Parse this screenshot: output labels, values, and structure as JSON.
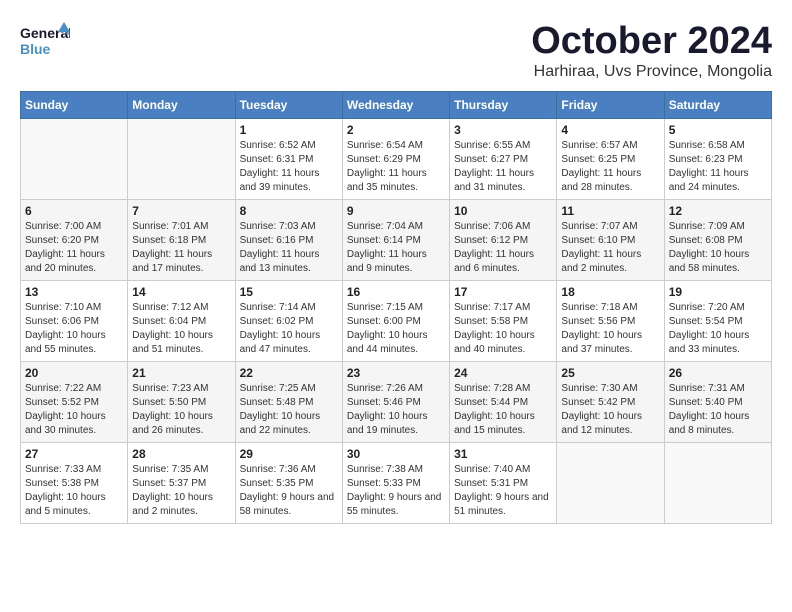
{
  "header": {
    "logo": {
      "general": "General",
      "blue": "Blue"
    },
    "month": "October 2024",
    "location": "Harhiraa, Uvs Province, Mongolia"
  },
  "weekdays": [
    "Sunday",
    "Monday",
    "Tuesday",
    "Wednesday",
    "Thursday",
    "Friday",
    "Saturday"
  ],
  "weeks": [
    [
      {
        "day": "",
        "sunrise": "",
        "sunset": "",
        "daylight": ""
      },
      {
        "day": "",
        "sunrise": "",
        "sunset": "",
        "daylight": ""
      },
      {
        "day": "1",
        "sunrise": "Sunrise: 6:52 AM",
        "sunset": "Sunset: 6:31 PM",
        "daylight": "Daylight: 11 hours and 39 minutes."
      },
      {
        "day": "2",
        "sunrise": "Sunrise: 6:54 AM",
        "sunset": "Sunset: 6:29 PM",
        "daylight": "Daylight: 11 hours and 35 minutes."
      },
      {
        "day": "3",
        "sunrise": "Sunrise: 6:55 AM",
        "sunset": "Sunset: 6:27 PM",
        "daylight": "Daylight: 11 hours and 31 minutes."
      },
      {
        "day": "4",
        "sunrise": "Sunrise: 6:57 AM",
        "sunset": "Sunset: 6:25 PM",
        "daylight": "Daylight: 11 hours and 28 minutes."
      },
      {
        "day": "5",
        "sunrise": "Sunrise: 6:58 AM",
        "sunset": "Sunset: 6:23 PM",
        "daylight": "Daylight: 11 hours and 24 minutes."
      }
    ],
    [
      {
        "day": "6",
        "sunrise": "Sunrise: 7:00 AM",
        "sunset": "Sunset: 6:20 PM",
        "daylight": "Daylight: 11 hours and 20 minutes."
      },
      {
        "day": "7",
        "sunrise": "Sunrise: 7:01 AM",
        "sunset": "Sunset: 6:18 PM",
        "daylight": "Daylight: 11 hours and 17 minutes."
      },
      {
        "day": "8",
        "sunrise": "Sunrise: 7:03 AM",
        "sunset": "Sunset: 6:16 PM",
        "daylight": "Daylight: 11 hours and 13 minutes."
      },
      {
        "day": "9",
        "sunrise": "Sunrise: 7:04 AM",
        "sunset": "Sunset: 6:14 PM",
        "daylight": "Daylight: 11 hours and 9 minutes."
      },
      {
        "day": "10",
        "sunrise": "Sunrise: 7:06 AM",
        "sunset": "Sunset: 6:12 PM",
        "daylight": "Daylight: 11 hours and 6 minutes."
      },
      {
        "day": "11",
        "sunrise": "Sunrise: 7:07 AM",
        "sunset": "Sunset: 6:10 PM",
        "daylight": "Daylight: 11 hours and 2 minutes."
      },
      {
        "day": "12",
        "sunrise": "Sunrise: 7:09 AM",
        "sunset": "Sunset: 6:08 PM",
        "daylight": "Daylight: 10 hours and 58 minutes."
      }
    ],
    [
      {
        "day": "13",
        "sunrise": "Sunrise: 7:10 AM",
        "sunset": "Sunset: 6:06 PM",
        "daylight": "Daylight: 10 hours and 55 minutes."
      },
      {
        "day": "14",
        "sunrise": "Sunrise: 7:12 AM",
        "sunset": "Sunset: 6:04 PM",
        "daylight": "Daylight: 10 hours and 51 minutes."
      },
      {
        "day": "15",
        "sunrise": "Sunrise: 7:14 AM",
        "sunset": "Sunset: 6:02 PM",
        "daylight": "Daylight: 10 hours and 47 minutes."
      },
      {
        "day": "16",
        "sunrise": "Sunrise: 7:15 AM",
        "sunset": "Sunset: 6:00 PM",
        "daylight": "Daylight: 10 hours and 44 minutes."
      },
      {
        "day": "17",
        "sunrise": "Sunrise: 7:17 AM",
        "sunset": "Sunset: 5:58 PM",
        "daylight": "Daylight: 10 hours and 40 minutes."
      },
      {
        "day": "18",
        "sunrise": "Sunrise: 7:18 AM",
        "sunset": "Sunset: 5:56 PM",
        "daylight": "Daylight: 10 hours and 37 minutes."
      },
      {
        "day": "19",
        "sunrise": "Sunrise: 7:20 AM",
        "sunset": "Sunset: 5:54 PM",
        "daylight": "Daylight: 10 hours and 33 minutes."
      }
    ],
    [
      {
        "day": "20",
        "sunrise": "Sunrise: 7:22 AM",
        "sunset": "Sunset: 5:52 PM",
        "daylight": "Daylight: 10 hours and 30 minutes."
      },
      {
        "day": "21",
        "sunrise": "Sunrise: 7:23 AM",
        "sunset": "Sunset: 5:50 PM",
        "daylight": "Daylight: 10 hours and 26 minutes."
      },
      {
        "day": "22",
        "sunrise": "Sunrise: 7:25 AM",
        "sunset": "Sunset: 5:48 PM",
        "daylight": "Daylight: 10 hours and 22 minutes."
      },
      {
        "day": "23",
        "sunrise": "Sunrise: 7:26 AM",
        "sunset": "Sunset: 5:46 PM",
        "daylight": "Daylight: 10 hours and 19 minutes."
      },
      {
        "day": "24",
        "sunrise": "Sunrise: 7:28 AM",
        "sunset": "Sunset: 5:44 PM",
        "daylight": "Daylight: 10 hours and 15 minutes."
      },
      {
        "day": "25",
        "sunrise": "Sunrise: 7:30 AM",
        "sunset": "Sunset: 5:42 PM",
        "daylight": "Daylight: 10 hours and 12 minutes."
      },
      {
        "day": "26",
        "sunrise": "Sunrise: 7:31 AM",
        "sunset": "Sunset: 5:40 PM",
        "daylight": "Daylight: 10 hours and 8 minutes."
      }
    ],
    [
      {
        "day": "27",
        "sunrise": "Sunrise: 7:33 AM",
        "sunset": "Sunset: 5:38 PM",
        "daylight": "Daylight: 10 hours and 5 minutes."
      },
      {
        "day": "28",
        "sunrise": "Sunrise: 7:35 AM",
        "sunset": "Sunset: 5:37 PM",
        "daylight": "Daylight: 10 hours and 2 minutes."
      },
      {
        "day": "29",
        "sunrise": "Sunrise: 7:36 AM",
        "sunset": "Sunset: 5:35 PM",
        "daylight": "Daylight: 9 hours and 58 minutes."
      },
      {
        "day": "30",
        "sunrise": "Sunrise: 7:38 AM",
        "sunset": "Sunset: 5:33 PM",
        "daylight": "Daylight: 9 hours and 55 minutes."
      },
      {
        "day": "31",
        "sunrise": "Sunrise: 7:40 AM",
        "sunset": "Sunset: 5:31 PM",
        "daylight": "Daylight: 9 hours and 51 minutes."
      },
      {
        "day": "",
        "sunrise": "",
        "sunset": "",
        "daylight": ""
      },
      {
        "day": "",
        "sunrise": "",
        "sunset": "",
        "daylight": ""
      }
    ]
  ]
}
